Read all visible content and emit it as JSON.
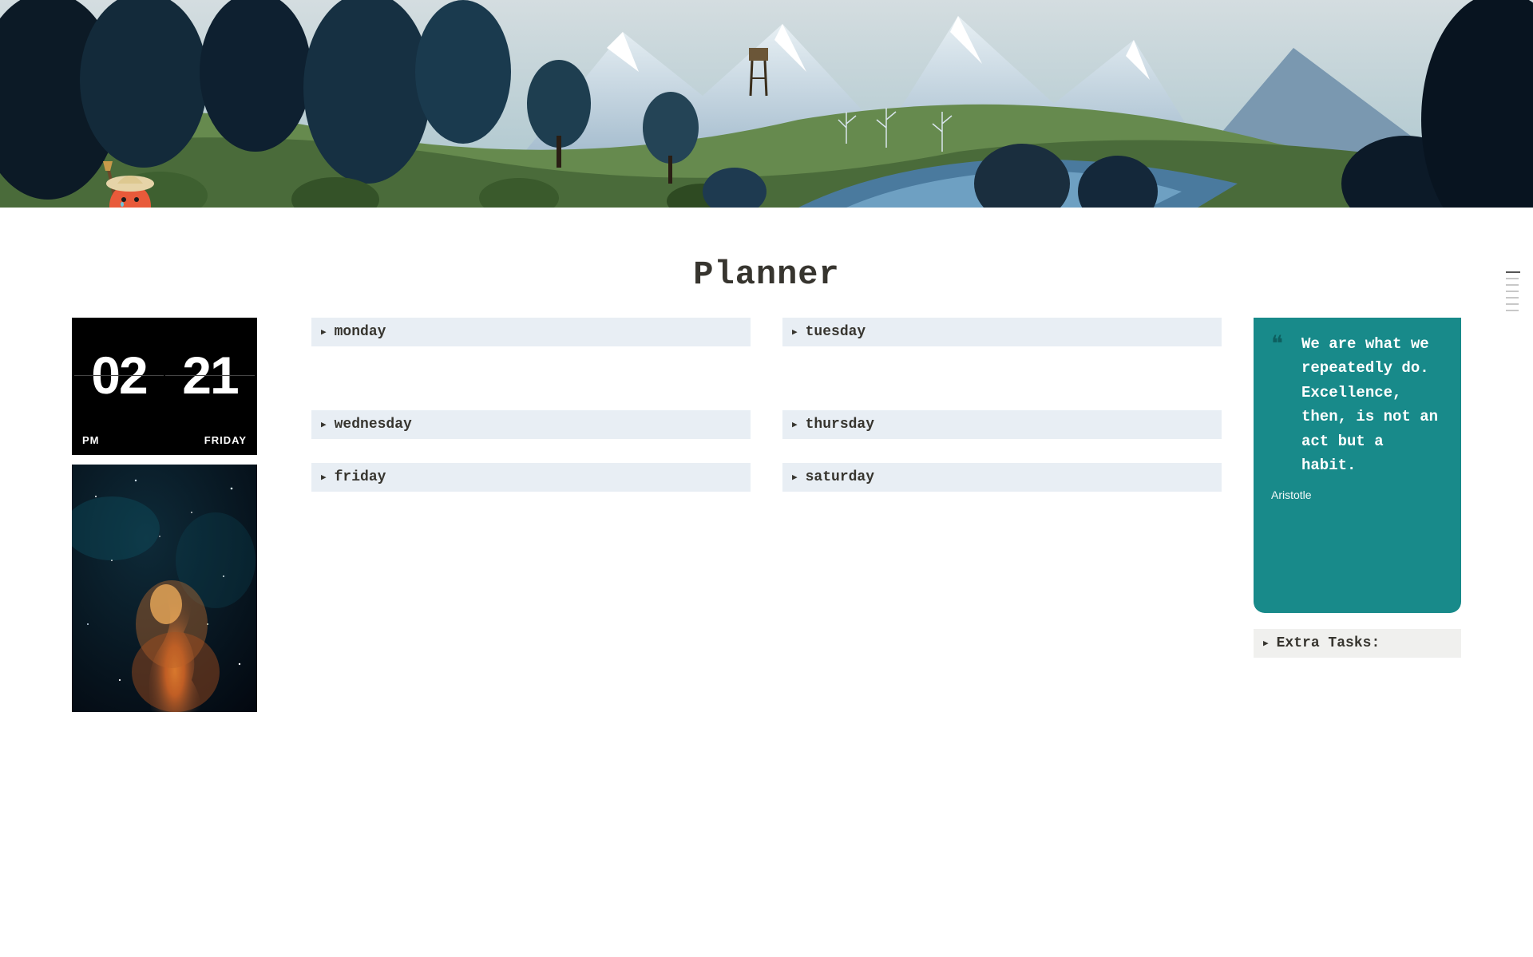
{
  "title": "Planner",
  "clock": {
    "hour": "02",
    "minute": "21",
    "meridiem": "PM",
    "weekday": "FRIDAY"
  },
  "days": {
    "monday": "monday",
    "tuesday": "tuesday",
    "wednesday": "wednesday",
    "thursday": "thursday",
    "friday": "friday",
    "saturday": "saturday"
  },
  "quote": {
    "text": "We are what we repeatedly do. Excellence, then, is not an act but a habit.",
    "author": "Aristotle"
  },
  "extra": {
    "label": "Extra Tasks:"
  },
  "colors": {
    "toggle_bg": "#e8eef4",
    "quote_bg": "#188a8a",
    "text": "#37352f"
  }
}
